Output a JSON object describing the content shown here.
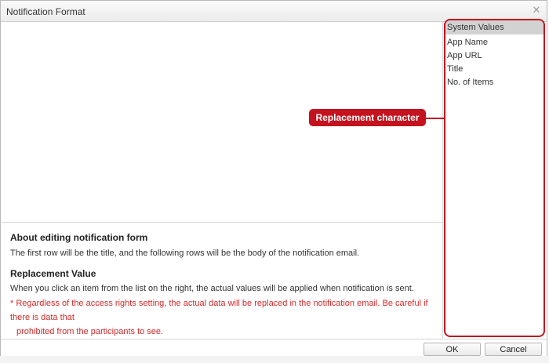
{
  "dialog": {
    "title": "Notification Format",
    "close_icon": "close-icon"
  },
  "editor": {
    "value": ""
  },
  "help": {
    "editing_heading": "About editing notification form",
    "editing_text": "The first row will be the title, and the following rows will be the body of the notification email.",
    "replacement_heading": "Replacement Value",
    "replacement_text": "When you click an item from the list on the right, the actual values will be applied when notification is sent.",
    "warning_line1": "* Regardless of the access rights setting, the actual data will be replaced in the notification email. Be careful if there is data that",
    "warning_line2": "prohibited from the participants to see."
  },
  "system_values": {
    "header": "System Values",
    "items": [
      "App Name",
      "App URL",
      "Title",
      "No. of Items"
    ]
  },
  "callout": {
    "label": "Replacement character"
  },
  "footer": {
    "ok_label": "OK",
    "cancel_label": "Cancel"
  },
  "colors": {
    "highlight": "#c4121e",
    "warning_text": "#d42a2a"
  }
}
